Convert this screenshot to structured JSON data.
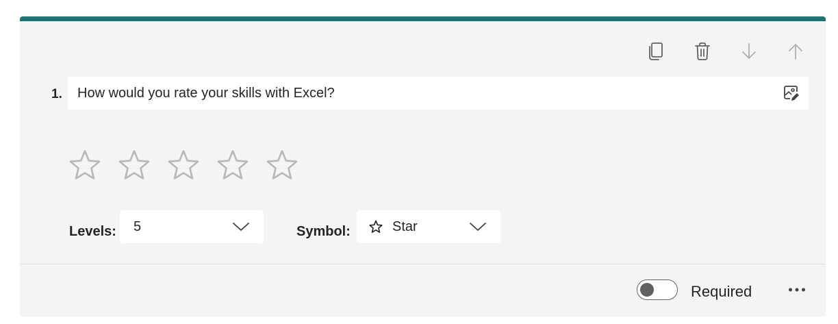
{
  "theme": {
    "accent": "#1e7270",
    "card_bg": "#f4f4f4",
    "star_outline": "#b8b8b8"
  },
  "toolbar": {
    "copy_icon": "copy-icon",
    "delete_icon": "trash-icon",
    "move_down_icon": "arrow-down-icon",
    "move_up_icon": "arrow-up-icon"
  },
  "question": {
    "number": "1.",
    "text": "How would you rate your skills with Excel?",
    "media_icon": "insert-image-icon"
  },
  "rating": {
    "symbol_icon": "star-icon",
    "levels": 5
  },
  "settings": {
    "levels_label": "Levels:",
    "levels_value": "5",
    "symbol_label": "Symbol:",
    "symbol_value": "Star"
  },
  "footer": {
    "required_label": "Required",
    "required_on": false,
    "more_icon": "more-options-icon"
  }
}
